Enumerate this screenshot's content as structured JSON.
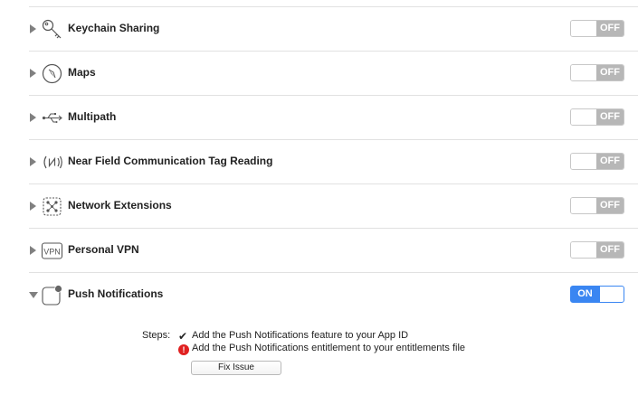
{
  "capabilities": [
    {
      "id": "keychain-sharing",
      "label": "Keychain Sharing",
      "icon": "key-icon",
      "state": "OFF",
      "expanded": false
    },
    {
      "id": "maps",
      "label": "Maps",
      "icon": "compass-icon",
      "state": "OFF",
      "expanded": false
    },
    {
      "id": "multipath",
      "label": "Multipath",
      "icon": "usb-icon",
      "state": "OFF",
      "expanded": false
    },
    {
      "id": "nfc",
      "label": "Near Field Communication Tag Reading",
      "icon": "nfc-icon",
      "state": "OFF",
      "expanded": false
    },
    {
      "id": "network-extensions",
      "label": "Network Extensions",
      "icon": "network-extension-icon",
      "state": "OFF",
      "expanded": false
    },
    {
      "id": "personal-vpn",
      "label": "Personal VPN",
      "icon": "vpn-icon",
      "vpn_icon_text": "VPN",
      "state": "OFF",
      "expanded": false
    },
    {
      "id": "push-notifications",
      "label": "Push Notifications",
      "icon": "notification-badge-icon",
      "state": "ON",
      "expanded": true
    }
  ],
  "steps": {
    "label": "Steps:",
    "items": [
      {
        "status": "done",
        "icon": "checkmark-icon",
        "text": "Add the Push Notifications feature to your App ID"
      },
      {
        "status": "error",
        "icon": "error-icon",
        "error_glyph": "!",
        "text": "Add the Push Notifications entitlement to your entitlements file"
      }
    ],
    "fix_button": "Fix Issue"
  },
  "colors": {
    "on_toggle": "#3a86f2",
    "off_toggle": "#b7b7b7",
    "error": "#e02020",
    "separator": "#e1e1e1"
  }
}
